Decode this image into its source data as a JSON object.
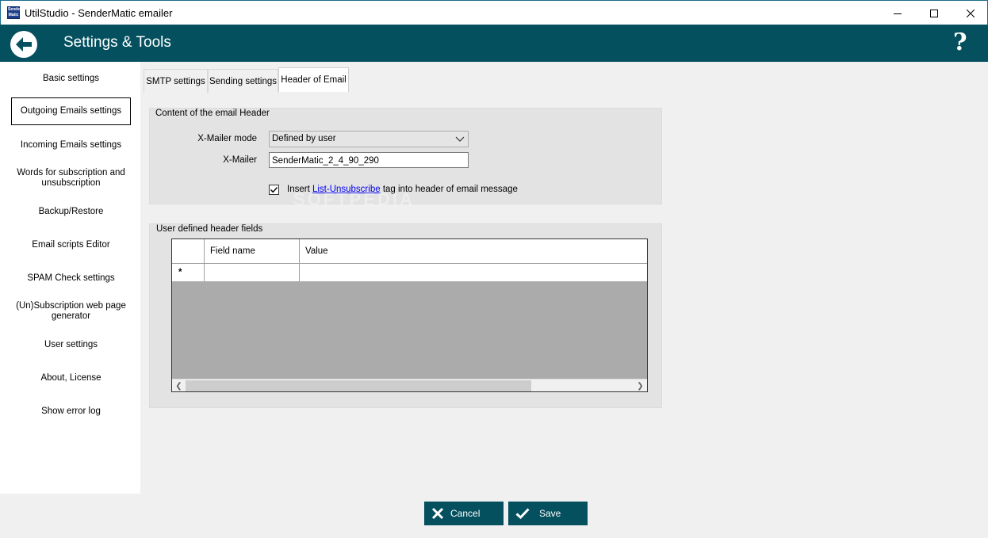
{
  "window": {
    "icon_text": [
      "Sender",
      "Matic"
    ],
    "title": "UtilStudio - SenderMatic emailer"
  },
  "header": {
    "title": "Settings & Tools",
    "help": "?"
  },
  "sidebar": {
    "items": [
      {
        "label": "Basic settings",
        "active": false
      },
      {
        "label": "Outgoing Emails settings",
        "active": true
      },
      {
        "label": "Incoming Emails settings",
        "active": false
      },
      {
        "label": "Words for subscription and unsubscription",
        "active": false
      },
      {
        "label": "Backup/Restore",
        "active": false
      },
      {
        "label": "Email scripts Editor",
        "active": false
      },
      {
        "label": "SPAM Check settings",
        "active": false
      },
      {
        "label": "(Un)Subscription web page generator",
        "active": false
      },
      {
        "label": "User settings",
        "active": false
      },
      {
        "label": "About, License",
        "active": false
      },
      {
        "label": "Show error log",
        "active": false
      }
    ]
  },
  "tabs": [
    {
      "label": "SMTP settings",
      "active": false
    },
    {
      "label": "Sending settings",
      "active": false
    },
    {
      "label": "Header of Email",
      "active": true
    }
  ],
  "header_content": {
    "group_label": "Content of the email Header",
    "xmailer_mode_label": "X-Mailer mode",
    "xmailer_mode_value": "Defined by user",
    "xmailer_label": "X-Mailer",
    "xmailer_value": "SenderMatic_2_4_90_290",
    "checkbox_checked": true,
    "checkbox_prefix": "Insert ",
    "checkbox_link": "List-Unsubscribe",
    "checkbox_suffix": " tag into header of email message"
  },
  "user_fields": {
    "group_label": "User defined header fields",
    "columns": [
      "Field name",
      "Value"
    ],
    "new_row_marker": "*"
  },
  "watermark": "SOFTPEDIA",
  "footer": {
    "cancel": "Cancel",
    "save": "Save"
  }
}
